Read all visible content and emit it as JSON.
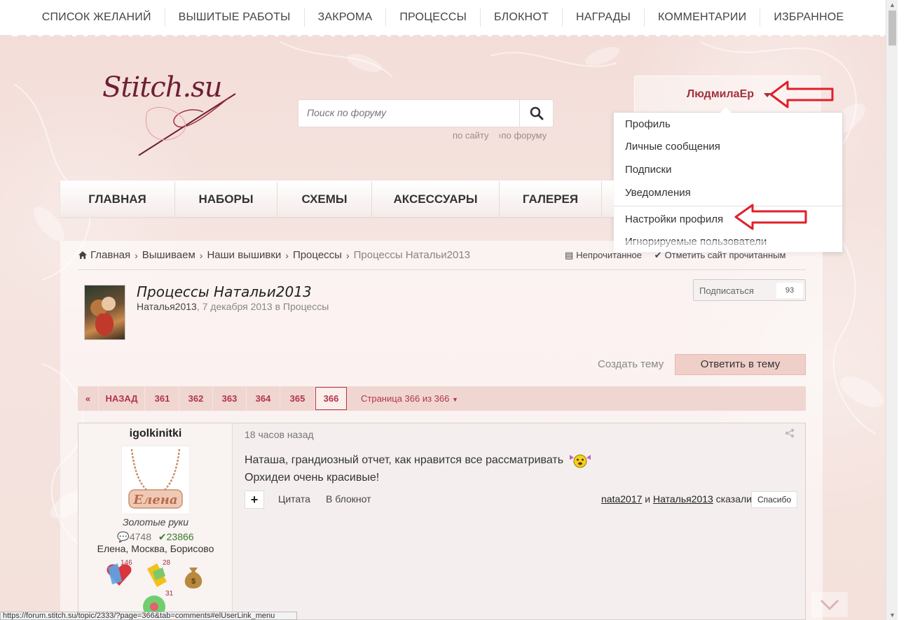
{
  "top_nav": [
    "СПИСОК ЖЕЛАНИЙ",
    "ВЫШИТЫЕ РАБОТЫ",
    "ЗАКРОМА",
    "ПРОЦЕССЫ",
    "БЛОКНОТ",
    "НАГРАДЫ",
    "КОММЕНТАРИИ",
    "ИЗБРАННОЕ"
  ],
  "logo": {
    "text": "Stitch.su"
  },
  "search": {
    "placeholder": "Поиск по форуму",
    "scope_site": "по сайту",
    "scope_forum": "›по форуму"
  },
  "user": {
    "name": "ЛюдмилаЕр"
  },
  "user_menu": [
    "Профиль",
    "Личные сообщения",
    "Подписки",
    "Уведомления",
    "Настройки профиля",
    "Игнорируемые пользователи"
  ],
  "main_nav": [
    "ГЛАВНАЯ",
    "НАБОРЫ",
    "СХЕМЫ",
    "АКСЕССУАРЫ",
    "ГАЛЕРЕЯ"
  ],
  "breadcrumb": [
    "Главная",
    "Вышиваем",
    "Наши вышивки",
    "Процессы",
    "Процессы Натальи2013"
  ],
  "breadcrumb_right": {
    "unread": "Непрочитанное",
    "mark_read": "Отметить сайт прочитанным"
  },
  "topic": {
    "title": "Процессы Натальи2013",
    "author": "Наталья2013",
    "date": ", 7 декабря 2013 в Процессы",
    "subscribe_label": "Подписаться",
    "subscribe_count": "93",
    "create_topic": "Создать тему",
    "reply": "Ответить в тему"
  },
  "pager": {
    "back": "НАЗАД",
    "pages": [
      "361",
      "362",
      "363",
      "364",
      "365",
      "366"
    ],
    "info": "Страница 366 из 366"
  },
  "post": {
    "author": "igolkinitki",
    "avatar_text": "Елена",
    "rank": "Золотые руки",
    "posts": "4748",
    "rep": "23866",
    "location": "Елена, Москва, Борисово",
    "badges": [
      "146",
      "28",
      "31"
    ],
    "time": "18 часов назад",
    "line1": "Наташа, грандиозный отчет, как нравится все рассматривать",
    "line2": "Орхидеи очень красивые!",
    "quote": "Цитата",
    "notebook": "В блокнот",
    "thanks_user1": "nata2017",
    "thanks_and": " и ",
    "thanks_user2": "Наталья2013",
    "thanks_said": " сказали",
    "thanks_btn": "Спасибо"
  },
  "status_url": "https://forum.stitch.su/topic/2333/?page=366&tab=comments#elUserLink_menu",
  "colors": {
    "accent": "#a1313e",
    "annotation_red": "#e0202a"
  }
}
